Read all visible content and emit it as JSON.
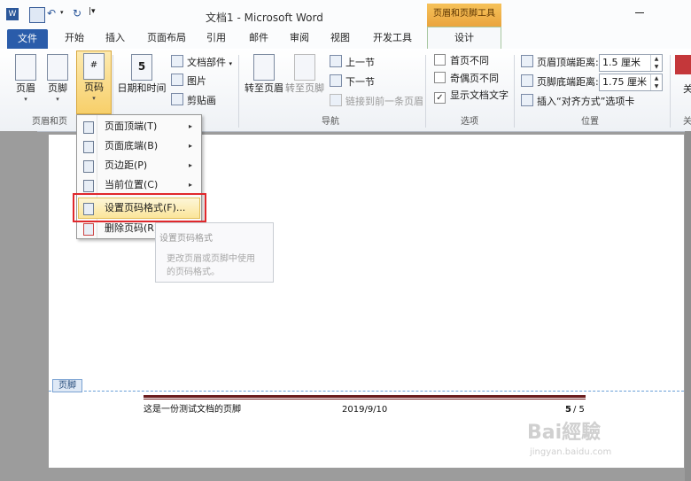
{
  "window": {
    "title": "文档1 - Microsoft Word",
    "context_tool": "页眉和页脚工具"
  },
  "tabs": [
    {
      "label": "文件"
    },
    {
      "label": "开始"
    },
    {
      "label": "插入"
    },
    {
      "label": "页面布局"
    },
    {
      "label": "引用"
    },
    {
      "label": "邮件"
    },
    {
      "label": "审阅"
    },
    {
      "label": "视图"
    },
    {
      "label": "开发工具"
    },
    {
      "label": "设计"
    }
  ],
  "ribbon": {
    "header": "页眉",
    "footer": "页脚",
    "pagenum": "页码",
    "datetime": "日期和时间",
    "docparts": "文档部件",
    "picture": "图片",
    "clipart": "剪贴画",
    "goto_header": "转至页眉",
    "goto_footer": "转至页脚",
    "prev": "上一节",
    "next": "下一节",
    "link_prev": "链接到前一条页眉",
    "opt_first": "首页不同",
    "opt_oddeven": "奇偶页不同",
    "opt_showtext": "显示文档文字",
    "header_dist_label": "页眉顶端距离:",
    "header_dist_value": "1.5 厘米",
    "footer_dist_label": "页脚底端距离:",
    "footer_dist_value": "1.75 厘米",
    "insert_align_tab": "插入“对齐方式”选项卡",
    "close_char": "关",
    "groups": {
      "hf": "页眉和页",
      "nav": "导航",
      "options": "选项",
      "position": "位置",
      "close": "关"
    }
  },
  "menu": [
    {
      "label": "页面顶端(T)",
      "arrow": "▸"
    },
    {
      "label": "页面底端(B)",
      "arrow": "▸"
    },
    {
      "label": "页边距(P)",
      "arrow": "▸"
    },
    {
      "label": "当前位置(C)",
      "arrow": "▸"
    },
    {
      "label": "设置页码格式(F)...",
      "arrow": ""
    },
    {
      "label": "删除页码(R)",
      "arrow": ""
    }
  ],
  "tooltip": {
    "title": "设置页码格式",
    "body1": "更改页眉或页脚中使用",
    "body2": "的页码格式。"
  },
  "doc": {
    "footer_tag": "页脚",
    "footer_text": "这是一份测试文档的页脚",
    "footer_date": "2019/9/10",
    "footer_page": "5",
    "footer_page_sep": "/ 5"
  },
  "watermark": {
    "logo": "Bai經驗",
    "url": "jingyan.baidu.com"
  }
}
